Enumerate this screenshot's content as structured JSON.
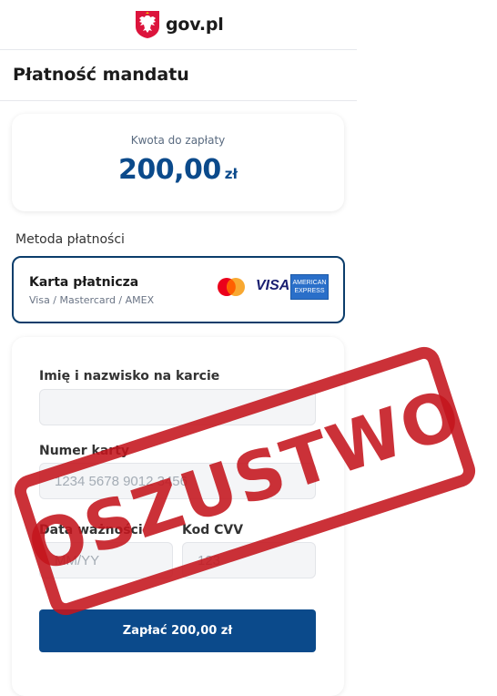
{
  "header": {
    "brand": "gov.pl",
    "logo_icon": "polish-eagle-emblem"
  },
  "page": {
    "title": "Płatność mandatu"
  },
  "amount": {
    "label": "Kwota do zapłaty",
    "value": "200,00",
    "currency": "zł"
  },
  "payment": {
    "section_label": "Metoda płatności",
    "method_title": "Karta płatnicza",
    "method_subtitle": "Visa / Mastercard / AMEX",
    "brands": [
      "mastercard-logo",
      "visa-logo",
      "amex-logo"
    ],
    "visa_text": "VISA",
    "amex_line1": "AMERICAN",
    "amex_line2": "EXPRESS"
  },
  "form": {
    "name_label": "Imię i nazwisko na karcie",
    "name_value": "",
    "card_label": "Numer karty",
    "card_placeholder": "1234 5678 9012 3456",
    "expiry_label": "Data ważności",
    "expiry_placeholder": "MM/YY",
    "cvv_label": "Kod CVV",
    "cvv_placeholder": "123",
    "pay_button": "Zapłać 200,00 zł"
  },
  "stamp": {
    "text": "OSZUSTWO"
  },
  "colors": {
    "primary": "#0b4a8b",
    "stamp_red": "#c4141c",
    "method_border": "#0b3d6b"
  }
}
